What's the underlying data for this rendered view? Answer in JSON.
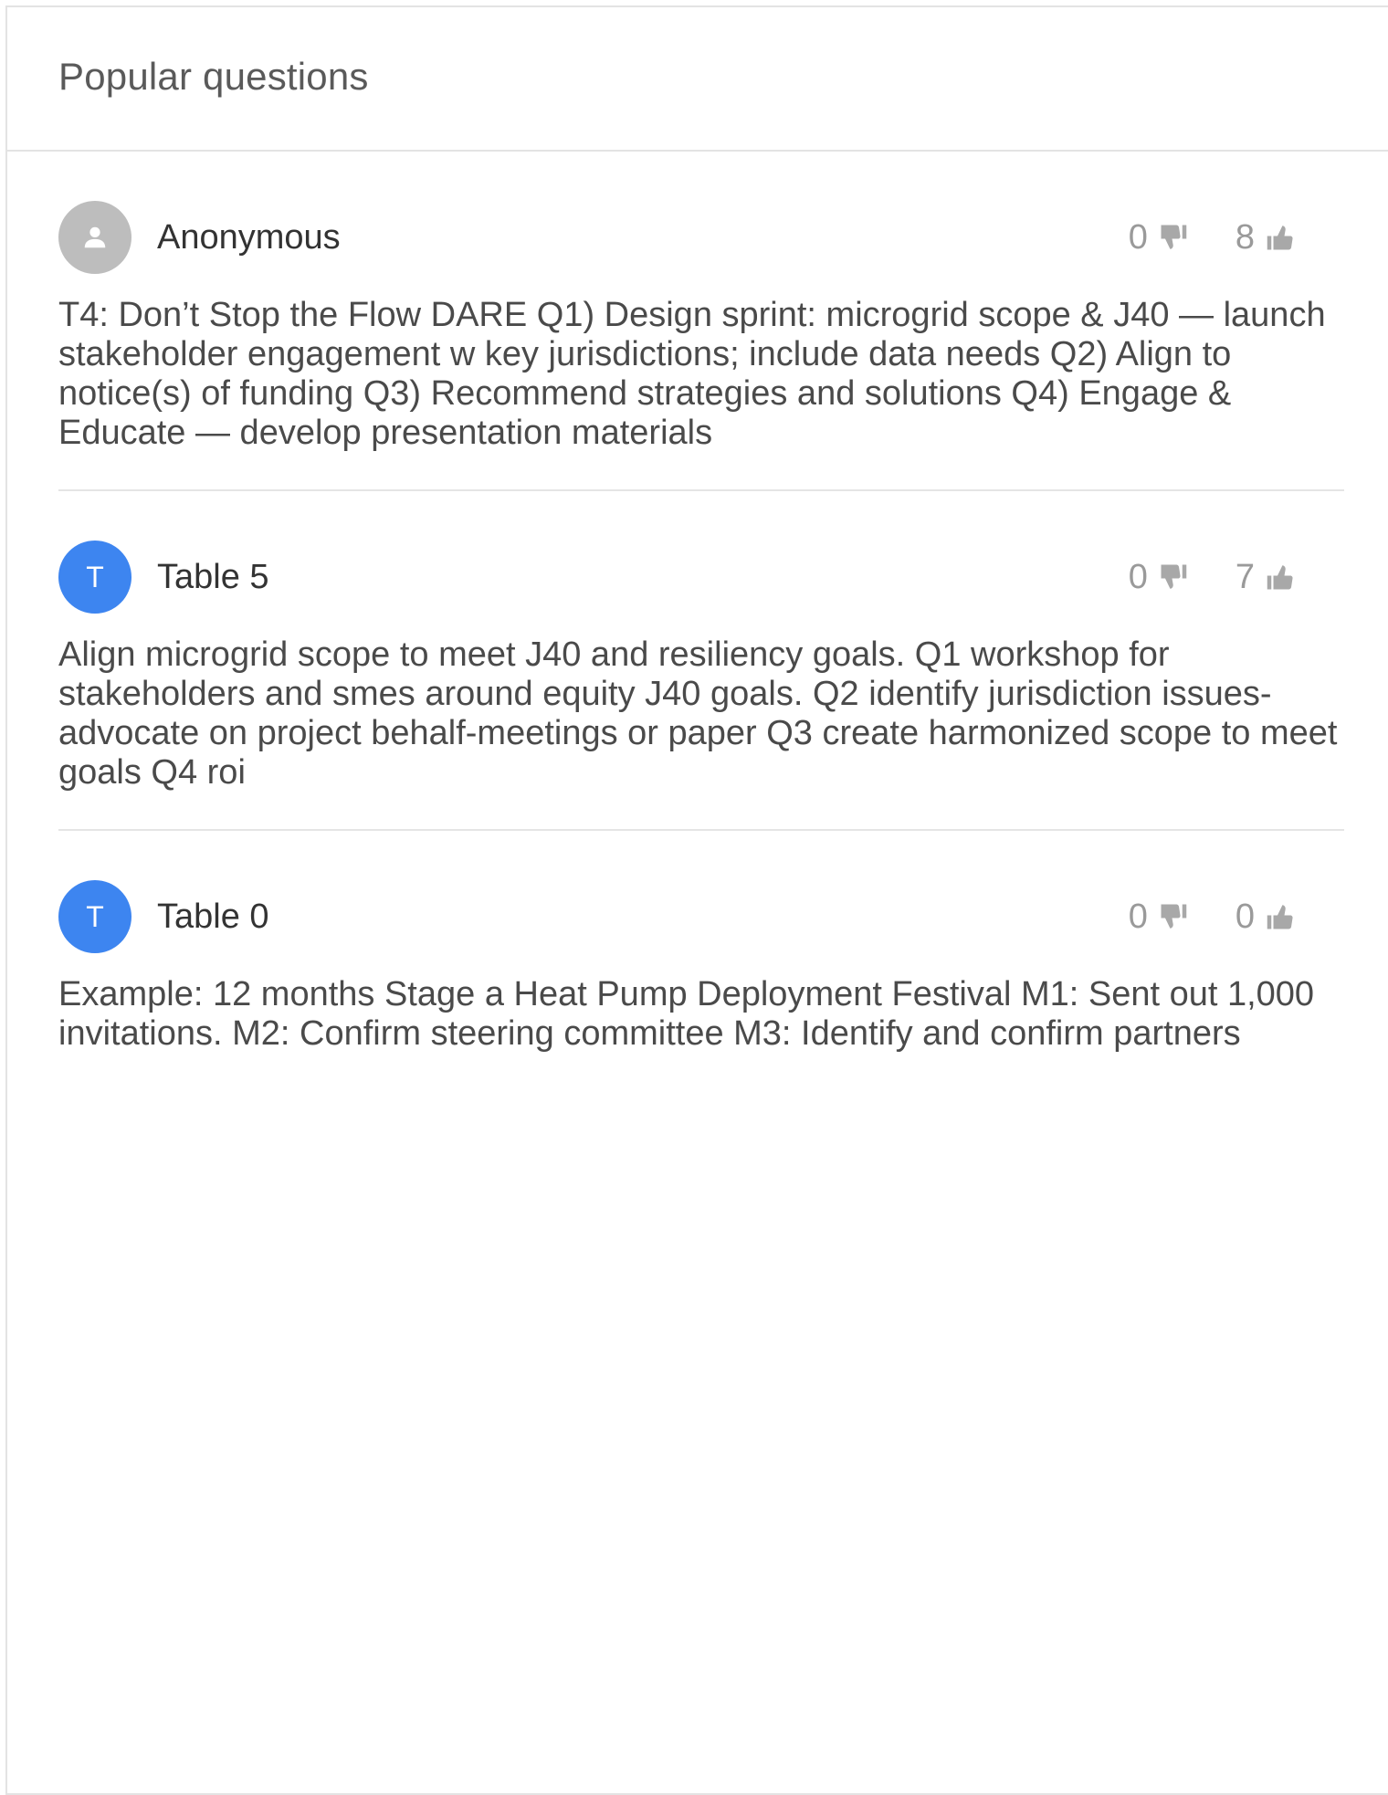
{
  "panel": {
    "title": "Popular questions"
  },
  "questions": [
    {
      "author": "Anonymous",
      "avatar_letter": "",
      "avatar_type": "anonymous",
      "dislikes": "0",
      "likes": "8",
      "text": "T4: Don’t Stop the Flow DARE Q1) Design sprint: microgrid scope & J40 — launch stakeholder engagement w key jurisdictions; include data needs Q2) Align to notice(s) of funding Q3) Recommend strategies and solutions Q4) Engage & Educate — develop presentation materials"
    },
    {
      "author": "Table 5",
      "avatar_letter": "T",
      "avatar_type": "letter",
      "dislikes": "0",
      "likes": "7",
      "text": "Align microgrid scope to meet J40 and resiliency goals. Q1 workshop for stakeholders and smes around equity J40 goals. Q2 identify jurisdiction issues- advocate on project behalf-meetings or paper Q3 create harmonized scope to meet goals Q4 roi"
    },
    {
      "author": "Table 0",
      "avatar_letter": "T",
      "avatar_type": "letter",
      "dislikes": "0",
      "likes": "0",
      "text": "Example: 12 months Stage a Heat Pump Deployment Festival M1: Sent out 1,000 invitations. M2: Confirm steering committee M3: Identify and confirm partners"
    }
  ],
  "icons": {
    "avatar_anonymous": "user-icon",
    "dislike": "thumbs-down-icon",
    "like": "thumbs-up-icon"
  },
  "colors": {
    "avatar_letter_bg": "#3d85f0",
    "avatar_anonymous_bg": "#bdbdbd",
    "vote_gray": "#9a9a9a"
  }
}
